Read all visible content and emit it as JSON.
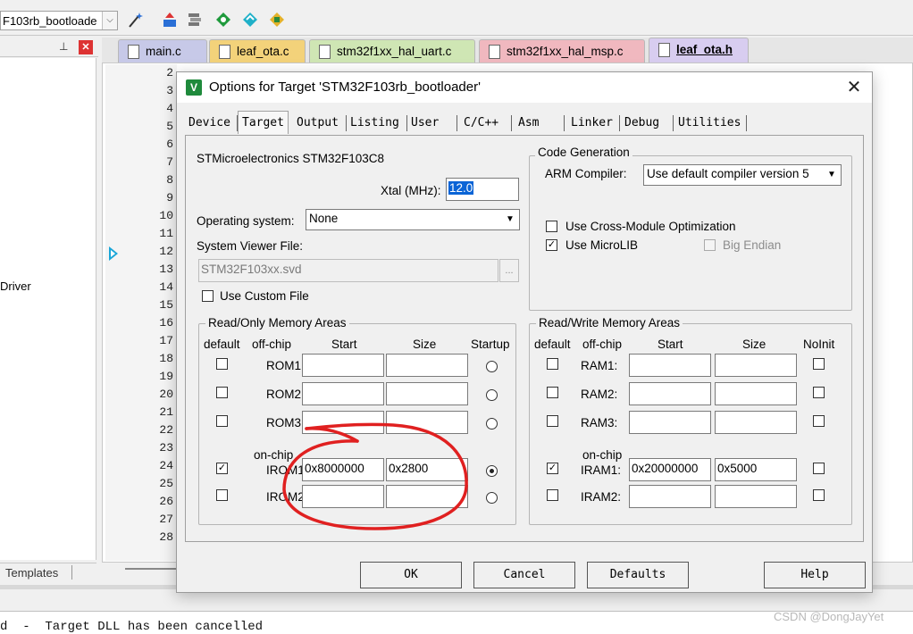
{
  "toolbar": {
    "target_combo": "F103rb_bootloade",
    "icons": [
      "magic-wand-icon",
      "load-icon",
      "stack-icon",
      "diamond-icon",
      "debug-diamond-icon",
      "components-icon"
    ]
  },
  "project_pane": {
    "visible_item": "Driver",
    "bottom_tab": "Templates"
  },
  "editor": {
    "tabs": [
      {
        "label": "main.c",
        "color": "#c7c9e8"
      },
      {
        "label": "leaf_ota.c",
        "color": "#f3d27a"
      },
      {
        "label": "stm32f1xx_hal_uart.c",
        "color": "#cfe6b4"
      },
      {
        "label": "stm32f1xx_hal_msp.c",
        "color": "#f0b8bf"
      },
      {
        "label": "leaf_ota.h",
        "color": "#d8cdf0"
      }
    ],
    "line_numbers": [
      "2",
      "3",
      "4",
      "5",
      "6",
      "7",
      "8",
      "9",
      "10",
      "11",
      "12",
      "13",
      "14",
      "15",
      "16",
      "17",
      "18",
      "19",
      "20",
      "21",
      "22",
      "23",
      "24",
      "25",
      "26",
      "27",
      "28"
    ]
  },
  "dialog": {
    "title": "Options for Target 'STM32F103rb_bootloader'",
    "close_symbol": "✕",
    "tabs": [
      "Device",
      "Target",
      "Output",
      "Listing",
      "User",
      "C/C++",
      "Asm",
      "Linker",
      "Debug",
      "Utilities"
    ],
    "active_tab": "Target",
    "device_name": "STMicroelectronics STM32F103C8",
    "xtal_label": "Xtal (MHz):",
    "xtal_value": "12.0",
    "os_label": "Operating system:",
    "os_value": "None",
    "svd_label": "System Viewer File:",
    "svd_value": "STM32F103xx.svd",
    "browse_label": "...",
    "custom_file_label": "Use Custom File",
    "code_gen": {
      "title": "Code Generation",
      "compiler_label": "ARM Compiler:",
      "compiler_value": "Use default compiler version 5",
      "cross_module_label": "Use Cross-Module Optimization",
      "microlib_label": "Use MicroLIB",
      "big_endian_label": "Big Endian",
      "cross_module_checked": false,
      "microlib_checked": true,
      "big_endian_checked": false
    },
    "ro_memory": {
      "title": "Read/Only Memory Areas",
      "headers": {
        "default": "default",
        "offchip": "off-chip",
        "start": "Start",
        "size": "Size",
        "extra": "Startup"
      },
      "onchip_label": "on-chip",
      "rows": [
        {
          "label": "ROM1:",
          "start": "",
          "size": "",
          "default": false,
          "startup": false
        },
        {
          "label": "ROM2:",
          "start": "",
          "size": "",
          "default": false,
          "startup": false
        },
        {
          "label": "ROM3:",
          "start": "",
          "size": "",
          "default": false,
          "startup": false
        },
        {
          "label": "IROM1:",
          "start": "0x8000000",
          "size": "0x2800",
          "default": true,
          "startup": true
        },
        {
          "label": "IROM2:",
          "start": "",
          "size": "",
          "default": false,
          "startup": false
        }
      ]
    },
    "rw_memory": {
      "title": "Read/Write Memory Areas",
      "headers": {
        "default": "default",
        "offchip": "off-chip",
        "start": "Start",
        "size": "Size",
        "extra": "NoInit"
      },
      "onchip_label": "on-chip",
      "rows": [
        {
          "label": "RAM1:",
          "start": "",
          "size": "",
          "default": false,
          "noinit": false
        },
        {
          "label": "RAM2:",
          "start": "",
          "size": "",
          "default": false,
          "noinit": false
        },
        {
          "label": "RAM3:",
          "start": "",
          "size": "",
          "default": false,
          "noinit": false
        },
        {
          "label": "IRAM1:",
          "start": "0x20000000",
          "size": "0x5000",
          "default": true,
          "noinit": false
        },
        {
          "label": "IRAM2:",
          "start": "",
          "size": "",
          "default": false,
          "noinit": false
        }
      ]
    },
    "buttons": {
      "ok": "OK",
      "cancel": "Cancel",
      "defaults": "Defaults",
      "help": "Help"
    }
  },
  "annotation_color": "#e02020",
  "build_output": "d  -  Target DLL has been cancelled",
  "watermark": "CSDN @DongJayYet"
}
